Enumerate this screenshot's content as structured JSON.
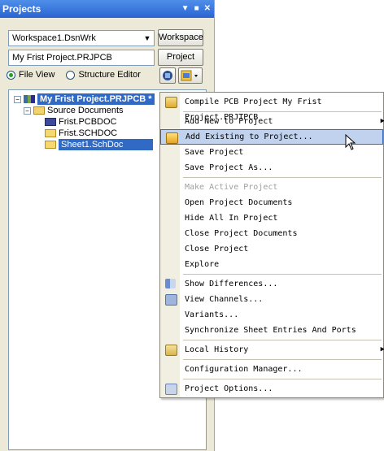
{
  "panel": {
    "title": "Projects",
    "controls": [
      "▼",
      "■",
      "✕"
    ],
    "workspace_combo_value": "Workspace1.DsnWrk",
    "workspace_button": "Workspace",
    "project_field_value": "My Frist Project.PRJPCB",
    "project_button": "Project",
    "view_options": [
      {
        "label": "File View",
        "selected": true
      },
      {
        "label": "Structure Editor",
        "selected": false
      }
    ]
  },
  "tree": {
    "project": "My Frist Project.PRJPCB *",
    "folder": "Source Documents",
    "documents": [
      "Frist.PCBDOC",
      "Frist.SCHDOC",
      "Sheet1.SchDoc"
    ]
  },
  "menu": {
    "items": [
      {
        "label": "Compile PCB Project My Frist Project.PRJTPCB",
        "icon": "compile-icon"
      },
      {
        "label": "Add New to Project",
        "submenu": true
      },
      {
        "label": "Add Existing to Project...",
        "icon": "add-existing-icon",
        "highlighted": true
      },
      {
        "label": "Save Project"
      },
      {
        "label": "Save Project As..."
      },
      {
        "label": "Make Active Project",
        "disabled": true
      },
      {
        "label": "Open Project Documents"
      },
      {
        "label": "Hide All In Project"
      },
      {
        "label": "Close Project Documents"
      },
      {
        "label": "Close Project"
      },
      {
        "label": "Explore"
      },
      {
        "label": "Show Differences...",
        "icon": "differences-icon"
      },
      {
        "label": "View Channels...",
        "icon": "channels-icon"
      },
      {
        "label": "Variants..."
      },
      {
        "label": "Synchronize Sheet Entries And Ports"
      },
      {
        "label": "Local History",
        "icon": "history-icon",
        "submenu": true
      },
      {
        "label": "Configuration Manager..."
      },
      {
        "label": "Project Options...",
        "icon": "options-icon"
      }
    ]
  },
  "colors": {
    "titlebar": "#2b63d1",
    "selection": "#316ac5",
    "menu_highlight": "#c1d2ee"
  }
}
